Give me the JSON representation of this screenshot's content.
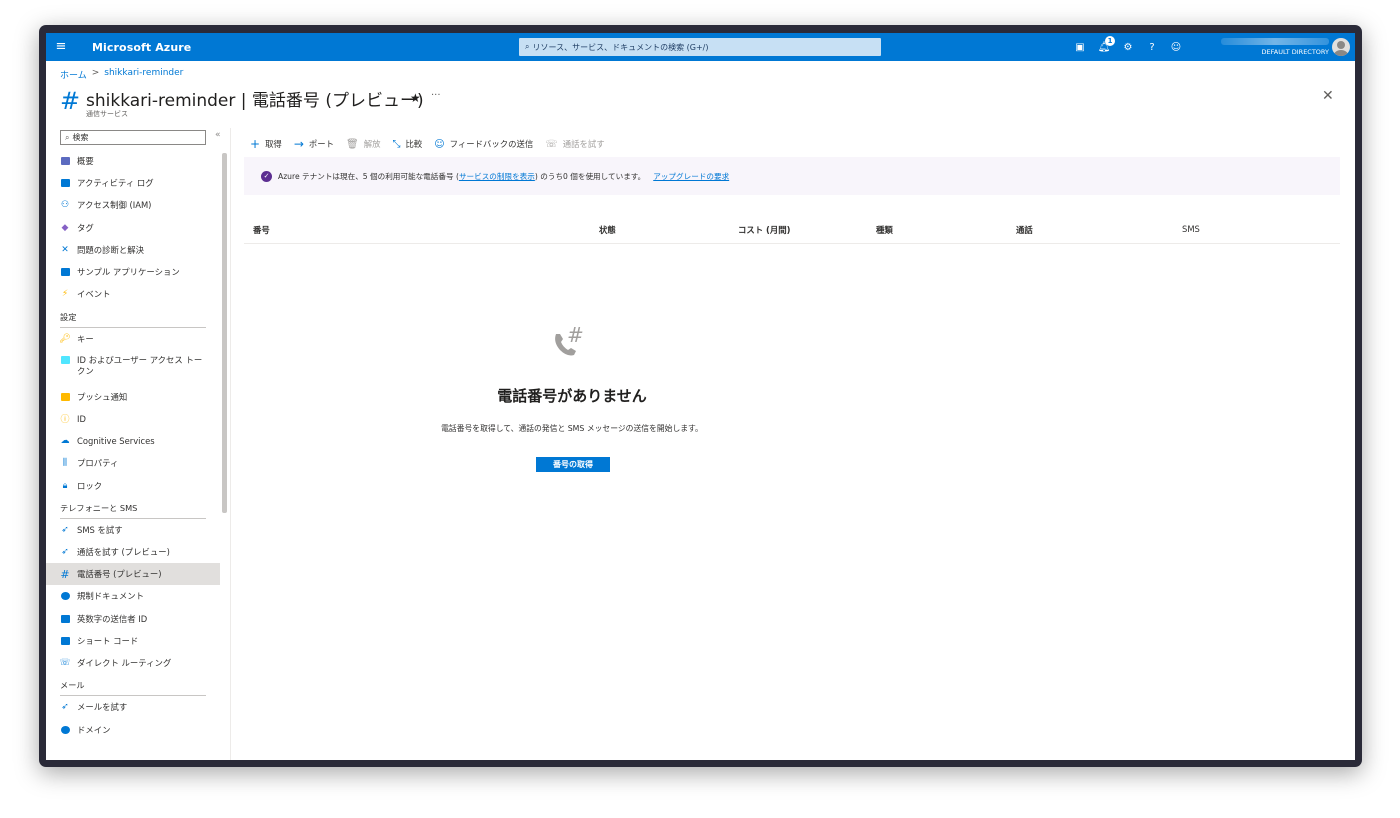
{
  "topbar": {
    "brand": "Microsoft Azure",
    "search_placeholder": "リソース、サービス、ドキュメントの検索 (G+/)",
    "notification_count": "1",
    "directory": "DEFAULT DIRECTORY",
    "accent_color": "#0078d4"
  },
  "breadcrumb": {
    "home": "ホーム",
    "sep": ">",
    "resource": "shikkari-reminder"
  },
  "header": {
    "title": "shikkari-reminder | 電話番号 (プレビュー)",
    "subtitle": "通信サービス",
    "star": "★",
    "more": "···",
    "close": "✕"
  },
  "sidebar": {
    "search_placeholder": "検索",
    "collapse": "«",
    "items": [
      {
        "label": "概要",
        "icon": "overview-icon"
      },
      {
        "label": "アクティビティ ログ",
        "icon": "activity-log-icon"
      },
      {
        "label": "アクセス制御 (IAM)",
        "icon": "access-control-icon"
      },
      {
        "label": "タグ",
        "icon": "tag-icon"
      },
      {
        "label": "問題の診断と解決",
        "icon": "diagnose-icon"
      },
      {
        "label": "サンプル アプリケーション",
        "icon": "sample-app-icon"
      },
      {
        "label": "イベント",
        "icon": "event-icon"
      }
    ],
    "settings_header": "設定",
    "settings_items": [
      {
        "label": "キー",
        "icon": "key-icon"
      },
      {
        "label": "ID およびユーザー アクセス トークン",
        "icon": "identity-token-icon"
      },
      {
        "label": "プッシュ通知",
        "icon": "push-notification-icon"
      },
      {
        "label": "ID",
        "icon": "id-icon"
      },
      {
        "label": "Cognitive Services",
        "icon": "cognitive-services-icon"
      },
      {
        "label": "プロパティ",
        "icon": "properties-icon"
      },
      {
        "label": "ロック",
        "icon": "lock-icon"
      }
    ],
    "telephony_header": "テレフォニーと SMS",
    "telephony_items": [
      {
        "label": "SMS を試す",
        "icon": "try-sms-icon"
      },
      {
        "label": "通話を試す (プレビュー)",
        "icon": "try-call-icon"
      },
      {
        "label": "電話番号 (プレビュー)",
        "icon": "phone-number-icon"
      },
      {
        "label": "規制ドキュメント",
        "icon": "regulatory-docs-icon"
      },
      {
        "label": "英数字の送信者 ID",
        "icon": "alphanumeric-sender-icon"
      },
      {
        "label": "ショート コード",
        "icon": "short-code-icon"
      },
      {
        "label": "ダイレクト ルーティング",
        "icon": "direct-routing-icon"
      }
    ],
    "mail_header": "メール",
    "mail_items": [
      {
        "label": "メールを試す",
        "icon": "try-email-icon"
      },
      {
        "label": "ドメイン",
        "icon": "domain-icon"
      }
    ]
  },
  "toolbar": {
    "get": "取得",
    "port": "ポート",
    "release": "解放",
    "compare": "比較",
    "feedback": "フィードバックの送信",
    "try_call": "通話を試す"
  },
  "notice": {
    "text_before": "Azure テナントは現在、5 個の利用可能な電話番号 (",
    "limit_link": "サービスの制限を表示",
    "text_after": ") のうち0 個を使用しています。",
    "upgrade_link": "アップグレードの要求"
  },
  "table": {
    "columns": [
      "番号",
      "状態",
      "コスト (月間)",
      "種類",
      "通話",
      "SMS"
    ]
  },
  "empty": {
    "title": "電話番号がありません",
    "description": "電話番号を取得して、通話の発信と SMS メッセージの送信を開始します。",
    "button": "番号の取得"
  }
}
